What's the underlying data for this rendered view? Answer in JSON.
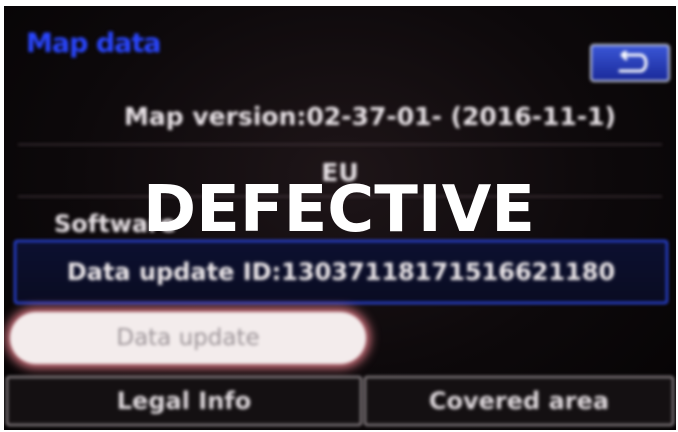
{
  "screen": {
    "title": "Map data",
    "back_icon": "back-arrow-icon",
    "map_version": "Map version:02-37-01- (2016-11-1)",
    "region": "EU",
    "software_label": "Software",
    "data_update_id": "Data update ID:13037118171516621180",
    "buttons": {
      "data_update": "Data update",
      "legal_info": "Legal Info",
      "covered_area": "Covered area"
    }
  },
  "overlay": {
    "stamp": "DEFECTIVE"
  },
  "colors": {
    "title": "#2a46ff",
    "highlight_border": "#2f4fff",
    "button_glow": "#e07a86",
    "background": "#0d090b"
  }
}
